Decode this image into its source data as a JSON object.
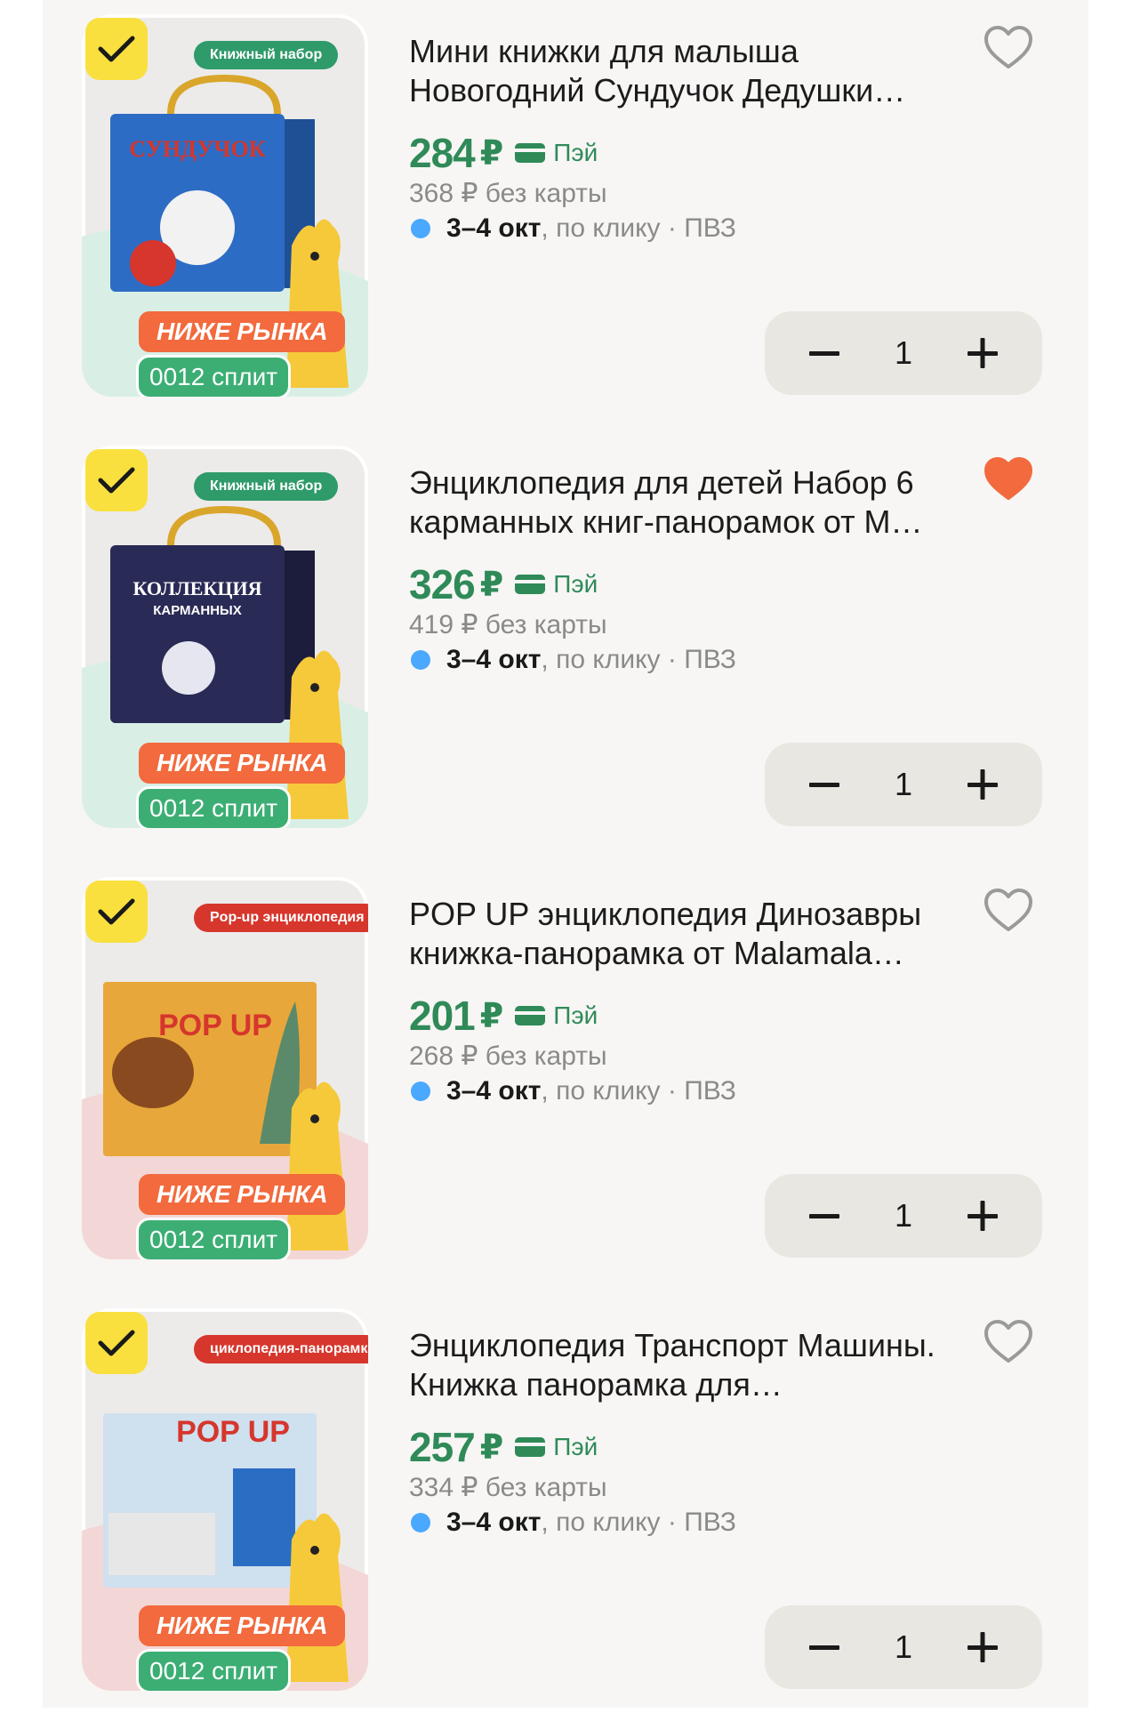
{
  "products": [
    {
      "checked": true,
      "chip": "Книжный набор",
      "chip_color": "green",
      "badge_low": "НИЖЕ РЫНКА",
      "badge_split": "0012 сплит",
      "title": "Мини книжки для малыша Новогодний Сундучок Дедушки…",
      "liked": false,
      "price": "284",
      "currency": "₽",
      "pay_label": "Пэй",
      "old_price": "368 ₽ без карты",
      "delivery_dates": "3–4 окт",
      "delivery_rest": ", по клику · ПВЗ",
      "quantity": "1",
      "art": "chest-blue"
    },
    {
      "checked": true,
      "chip": "Книжный набор",
      "chip_color": "green",
      "badge_low": "НИЖЕ РЫНКА",
      "badge_split": "0012 сплит",
      "title": "Энциклопедия для детей Набор 6 карманных книг-панорамок от М…",
      "liked": true,
      "price": "326",
      "currency": "₽",
      "pay_label": "Пэй",
      "old_price": "419 ₽ без карты",
      "delivery_dates": "3–4 окт",
      "delivery_rest": ", по клику · ПВЗ",
      "quantity": "1",
      "art": "chest-space"
    },
    {
      "checked": true,
      "chip": "Pop-up энциклопедия",
      "chip_color": "red",
      "badge_low": "НИЖЕ РЫНКА",
      "badge_split": "0012 сплит",
      "title": "POP UP энциклопедия Динозавры книжка-панорамка от Malamala…",
      "liked": false,
      "price": "201",
      "currency": "₽",
      "pay_label": "Пэй",
      "old_price": "268 ₽ без карты",
      "delivery_dates": "3–4 окт",
      "delivery_rest": ", по клику · ПВЗ",
      "quantity": "1",
      "art": "book-dino"
    },
    {
      "checked": true,
      "chip": "циклопедия-панорамка",
      "chip_color": "red",
      "badge_low": "НИЖЕ РЫНКА",
      "badge_split": "0012 сплит",
      "title": "Энциклопедия Транспорт Машины. Книжка панорамка для…",
      "liked": false,
      "price": "257",
      "currency": "₽",
      "pay_label": "Пэй",
      "old_price": "334 ₽ без карты",
      "delivery_dates": "3–4 окт",
      "delivery_rest": ", по клику · ПВЗ",
      "quantity": "1",
      "art": "book-transport"
    }
  ],
  "art_text": {
    "chest_blue": "СУНДУЧОК",
    "chest_space": "КОЛЛЕКЦИЯ",
    "chest_space_sub": "КАРМАННЫХ",
    "book_dino": "POP UP",
    "book_transport": "POP UP"
  },
  "colors": {
    "price_green": "#2f8a58",
    "like_active": "#f26a3d",
    "check_yellow": "#f9e03f",
    "delivery_dot": "#4aa8ff"
  }
}
